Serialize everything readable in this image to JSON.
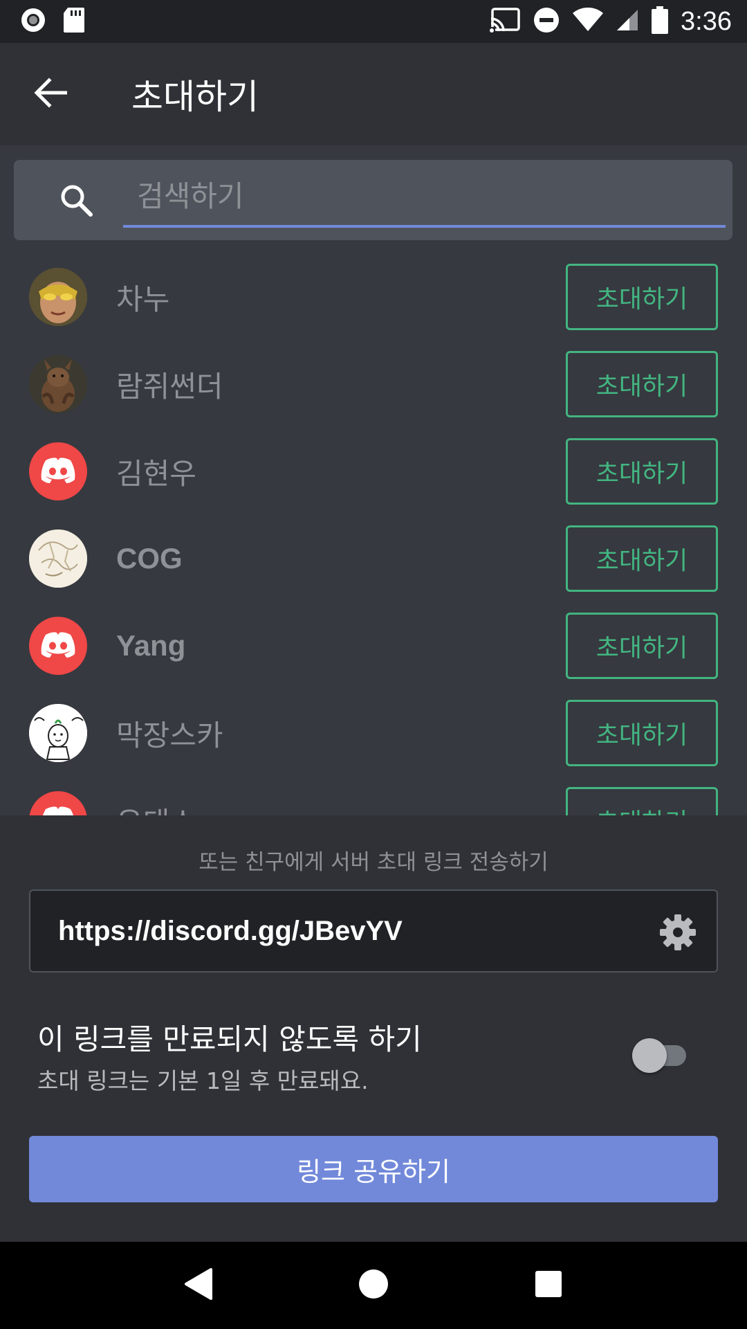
{
  "status_bar": {
    "time": "3:36"
  },
  "app_bar": {
    "title": "초대하기"
  },
  "search": {
    "placeholder": "검색하기"
  },
  "friends": [
    {
      "name": "차누",
      "invite_label": "초대하기",
      "avatar": "photo-gold-face"
    },
    {
      "name": "람쥐썬더",
      "invite_label": "초대하기",
      "avatar": "photo-squirrel"
    },
    {
      "name": "김현우",
      "invite_label": "초대하기",
      "avatar": "discord-default-red"
    },
    {
      "name": "COG",
      "invite_label": "초대하기",
      "avatar": "sketch-drawing"
    },
    {
      "name": "Yang",
      "invite_label": "초대하기",
      "avatar": "discord-default-red"
    },
    {
      "name": "막장스카",
      "invite_label": "초대하기",
      "avatar": "cartoon-character"
    },
    {
      "name": "유태스",
      "invite_label": "초대하기",
      "avatar": "discord-default-red"
    }
  ],
  "invite_panel": {
    "or_text": "또는 친구에게 서버 초대 링크 전송하기",
    "link": "https://discord.gg/JBevYV",
    "expire_title": "이 링크를 만료되지 않도록 하기",
    "expire_sub": "초대 링크는 기본 1일 후 만료돼요.",
    "expire_toggle_on": false,
    "share_label": "링크 공유하기"
  },
  "colors": {
    "background": "#36393f",
    "panel": "#2f3136",
    "accent": "#7289da",
    "invite_green": "#43b581",
    "discord_red": "#f04747"
  }
}
